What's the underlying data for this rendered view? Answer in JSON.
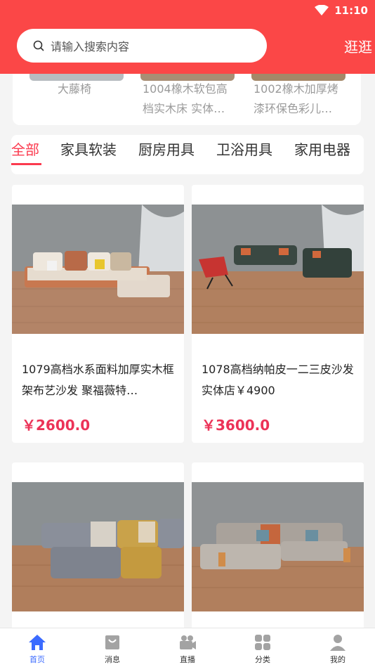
{
  "status": {
    "time": "11:10"
  },
  "search": {
    "placeholder": "请输入搜索内容"
  },
  "header": {
    "browse_label": "逛逛"
  },
  "top_products": [
    {
      "title": "大藤椅"
    },
    {
      "title_line1": "1004橡木软包高",
      "title_line2": "档实木床 实体…"
    },
    {
      "title_line1": "1002橡木加厚烤",
      "title_line2": "漆环保色彩儿…"
    }
  ],
  "tabs": [
    {
      "label": "全部"
    },
    {
      "label": "家具软装"
    },
    {
      "label": "厨房用具"
    },
    {
      "label": "卫浴用具"
    },
    {
      "label": "家用电器"
    }
  ],
  "products": [
    {
      "title": "1079高档水系面料加厚实木框架布艺沙发 聚福薇特…",
      "price": "￥2600.0"
    },
    {
      "title": "1078高档纳帕皮一二三皮沙发 实体店￥4900",
      "price": "￥3600.0"
    },
    {
      "title": "",
      "price": ""
    },
    {
      "title": "",
      "price": ""
    }
  ],
  "bottom_nav": [
    {
      "label": "首页",
      "icon": "home-icon"
    },
    {
      "label": "消息",
      "icon": "message-icon"
    },
    {
      "label": "直播",
      "icon": "live-icon"
    },
    {
      "label": "分类",
      "icon": "category-icon"
    },
    {
      "label": "我的",
      "icon": "profile-icon"
    }
  ],
  "colors": {
    "header": "#fb4747",
    "accent": "#ec3358",
    "nav_active": "#3b6bff"
  }
}
